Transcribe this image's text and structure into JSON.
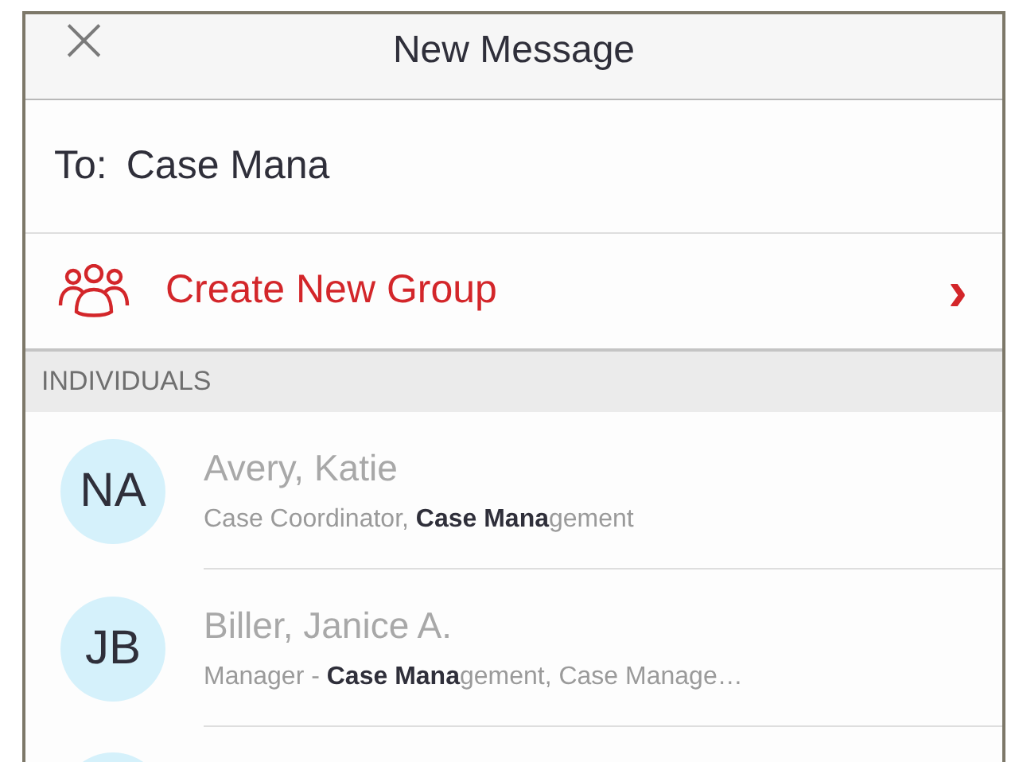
{
  "header": {
    "close": "×",
    "title": "New Message"
  },
  "to": {
    "label": "To:",
    "value": "Case Mana"
  },
  "create_group": {
    "label": "Create New Group",
    "chevron": "›"
  },
  "section": "INDIVIDUALS",
  "contacts": [
    {
      "initials": "NA",
      "name": "Avery, Katie",
      "detail": "Case Coordinator, **Case Mana**gement"
    },
    {
      "initials": "JB",
      "name": "Biller, Janice A.",
      "detail": "Manager - **Case Mana**gement, Case Manage…"
    }
  ]
}
